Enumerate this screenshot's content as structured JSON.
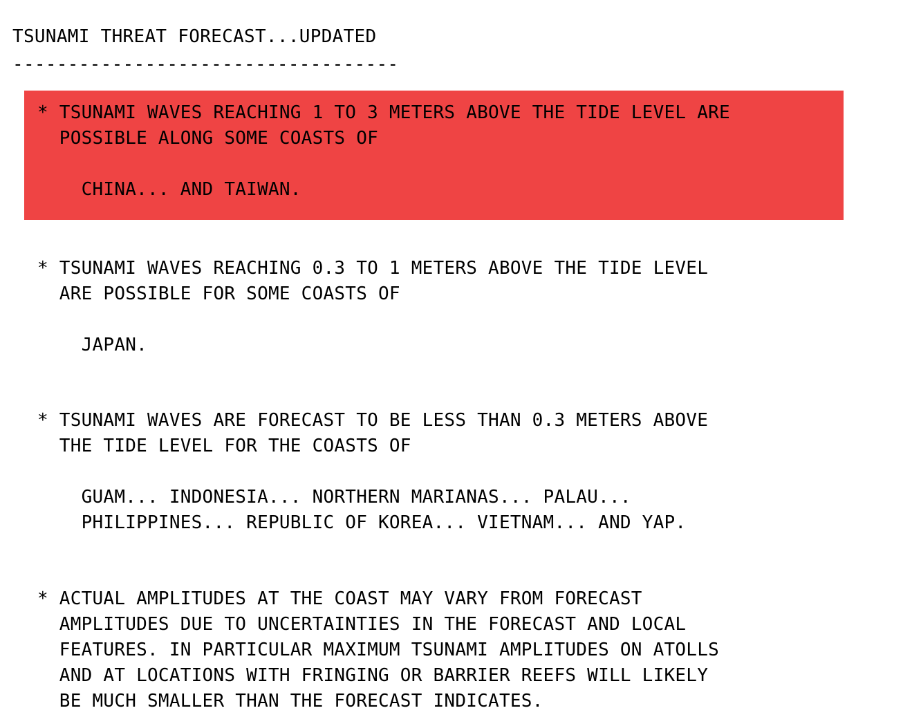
{
  "document": {
    "title": "TSUNAMI THREAT FORECAST...UPDATED",
    "rule": "-----------------------------------"
  },
  "colors": {
    "alert_background": "#ef4444",
    "page_background": "#ffffff",
    "text": "#000000"
  },
  "sections": {
    "alert": {
      "highlighted": true,
      "bullet_line_1": "* TSUNAMI WAVES REACHING 1 TO 3 METERS ABOVE THE TIDE LEVEL ARE",
      "bullet_line_2": "  POSSIBLE ALONG SOME COASTS OF",
      "locations": "    CHINA... AND TAIWAN."
    },
    "moderate": {
      "highlighted": false,
      "bullet_line_1": "* TSUNAMI WAVES REACHING 0.3 TO 1 METERS ABOVE THE TIDE LEVEL",
      "bullet_line_2": "  ARE POSSIBLE FOR SOME COASTS OF",
      "locations": "    JAPAN."
    },
    "minor": {
      "highlighted": false,
      "bullet_line_1": "* TSUNAMI WAVES ARE FORECAST TO BE LESS THAN 0.3 METERS ABOVE",
      "bullet_line_2": "  THE TIDE LEVEL FOR THE COASTS OF",
      "locations_line_1": "    GUAM... INDONESIA... NORTHERN MARIANAS... PALAU...",
      "locations_line_2": "    PHILIPPINES... REPUBLIC OF KOREA... VIETNAM... AND YAP."
    },
    "disclaimer": {
      "highlighted": false,
      "line_1": "* ACTUAL AMPLITUDES AT THE COAST MAY VARY FROM FORECAST",
      "line_2": "  AMPLITUDES DUE TO UNCERTAINTIES IN THE FORECAST AND LOCAL",
      "line_3": "  FEATURES. IN PARTICULAR MAXIMUM TSUNAMI AMPLITUDES ON ATOLLS",
      "line_4": "  AND AT LOCATIONS WITH FRINGING OR BARRIER REEFS WILL LIKELY",
      "line_5": "  BE MUCH SMALLER THAN THE FORECAST INDICATES."
    }
  }
}
